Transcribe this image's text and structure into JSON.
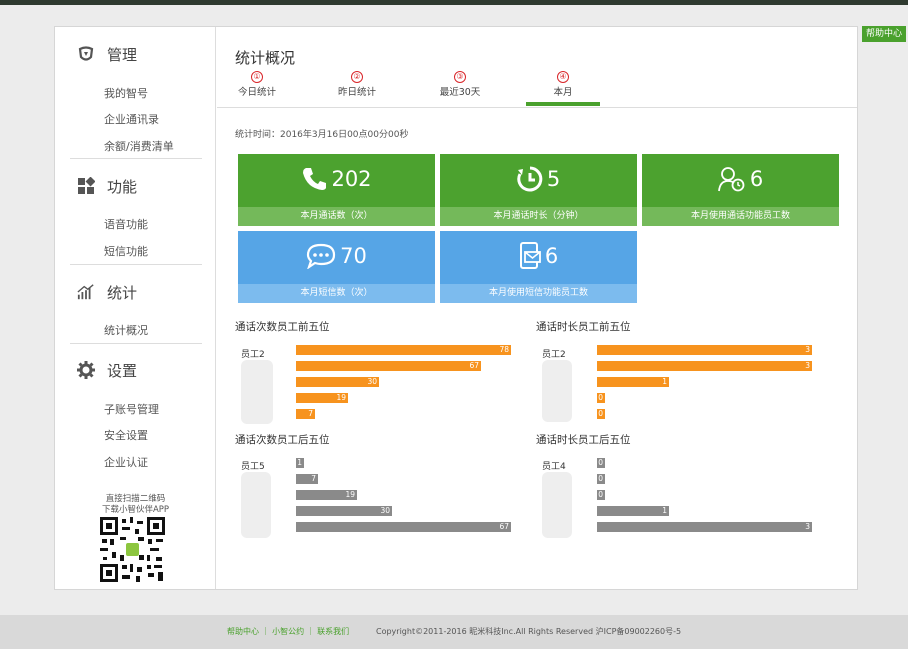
{
  "help_center": "帮助中心",
  "sidebar": {
    "sections": [
      {
        "title": "管理",
        "icon": "shield-icon",
        "items": [
          "我的智号",
          "企业通讯录",
          "余额/消费清单"
        ]
      },
      {
        "title": "功能",
        "icon": "grid-icon",
        "items": [
          "语音功能",
          "短信功能"
        ]
      },
      {
        "title": "统计",
        "icon": "chart-icon",
        "items": [
          "统计概况"
        ]
      },
      {
        "title": "设置",
        "icon": "gear-icon",
        "items": [
          "子账号管理",
          "安全设置",
          "企业认证"
        ]
      }
    ],
    "qr_caption_1": "直接扫描二维码",
    "qr_caption_2": "下载小智伙伴APP"
  },
  "main": {
    "title": "统计概况",
    "tabs": [
      {
        "num": "①",
        "label": "今日统计"
      },
      {
        "num": "②",
        "label": "昨日统计"
      },
      {
        "num": "③",
        "label": "最近30天"
      },
      {
        "num": "④",
        "label": "本月",
        "active": true
      }
    ],
    "stat_time": "统计时间：2016年3月16日00点00分00秒",
    "tiles": [
      {
        "value": "202",
        "caption": "本月通话数（次）",
        "icon": "phone-icon",
        "color": "green"
      },
      {
        "value": "5",
        "caption": "本月通话时长（分钟）",
        "icon": "clock-icon",
        "color": "green"
      },
      {
        "value": "6",
        "caption": "本月使用通话功能员工数",
        "icon": "user-clock-icon",
        "color": "green"
      },
      {
        "value": "70",
        "caption": "本月短信数（次）",
        "icon": "chat-icon",
        "color": "blue"
      },
      {
        "value": "6",
        "caption": "本月使用短信功能员工数",
        "icon": "sms-icon",
        "color": "blue"
      }
    ]
  },
  "chart_data": [
    {
      "type": "bar",
      "title": "通话次数员工前五位",
      "categories": [
        "员工2",
        "",
        "",
        "",
        ""
      ],
      "values": [
        78,
        67,
        30,
        19,
        7
      ],
      "color": "#f7931e"
    },
    {
      "type": "bar",
      "title": "通话时长员工前五位",
      "categories": [
        "员工2",
        "",
        "",
        "",
        ""
      ],
      "values": [
        3,
        3,
        1,
        0,
        0
      ],
      "color": "#f7931e"
    },
    {
      "type": "bar",
      "title": "通话次数员工后五位",
      "categories": [
        "员工5",
        "",
        "",
        "",
        ""
      ],
      "values": [
        1,
        7,
        19,
        30,
        67
      ],
      "color": "#8a8a8a"
    },
    {
      "type": "bar",
      "title": "通话时长员工后五位",
      "categories": [
        "员工4",
        "",
        "",
        "",
        ""
      ],
      "values": [
        0,
        0,
        0,
        1,
        3
      ],
      "color": "#8a8a8a"
    }
  ],
  "footer": {
    "links": "帮助中心 ｜ 小智公约 ｜ 联系我们",
    "copyright": "Copyright©2011-2016 昵米科技Inc.All Rights Reserved 沪ICP备09002260号-5"
  }
}
